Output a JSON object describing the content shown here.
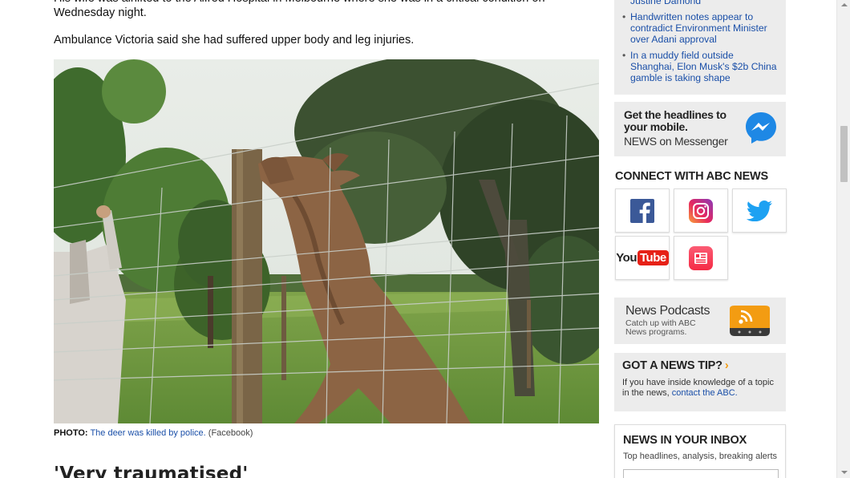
{
  "article": {
    "paragraph_1": "His wife was airlifted to the Alfred Hospital in Melbourne where she was in a critical condition on Wednesday night.",
    "paragraph_2": "Ambulance Victoria said she had suffered upper body and leg injuries.",
    "photo_caption_label": "PHOTO:",
    "photo_caption_link": "The deer was killed by police.",
    "photo_caption_source": "(Facebook)",
    "subheading": "'Very traumatised'"
  },
  "sidebar": {
    "related_stories": [
      "Justine Damond",
      "Handwritten notes appear to contradict Environment Minister over Adani approval",
      "In a muddy field outside Shanghai, Elon Musk's $2b China gamble is taking shape"
    ],
    "messenger": {
      "headline": "Get the headlines to your mobile.",
      "tagline": "NEWS on Messenger"
    },
    "connect_title": "CONNECT WITH ABC NEWS",
    "social": {
      "facebook": "f",
      "youtube_you": "You",
      "youtube_tube": "Tube"
    },
    "podcasts": {
      "title": "News Podcasts",
      "description": "Catch up with ABC News programs."
    },
    "news_tip": {
      "title": "GOT A NEWS TIP?",
      "chevron": "›",
      "text": "If you have inside knowledge of a topic in the news, ",
      "link": "contact the ABC."
    },
    "inbox": {
      "title": "NEWS IN YOUR INBOX",
      "text": "Top headlines, analysis, breaking alerts"
    }
  },
  "colors": {
    "link": "#1a4fa8",
    "facebook": "#3b5998",
    "twitter": "#1da1f2",
    "youtube": "#e62117",
    "messenger": "#1e88e5",
    "podcast_orange": "#f39c12",
    "tip_chevron": "#f39c12"
  },
  "icons": [
    "messenger-icon",
    "facebook-icon",
    "instagram-icon",
    "twitter-icon",
    "youtube-icon",
    "apple-news-icon",
    "rss-icon"
  ]
}
